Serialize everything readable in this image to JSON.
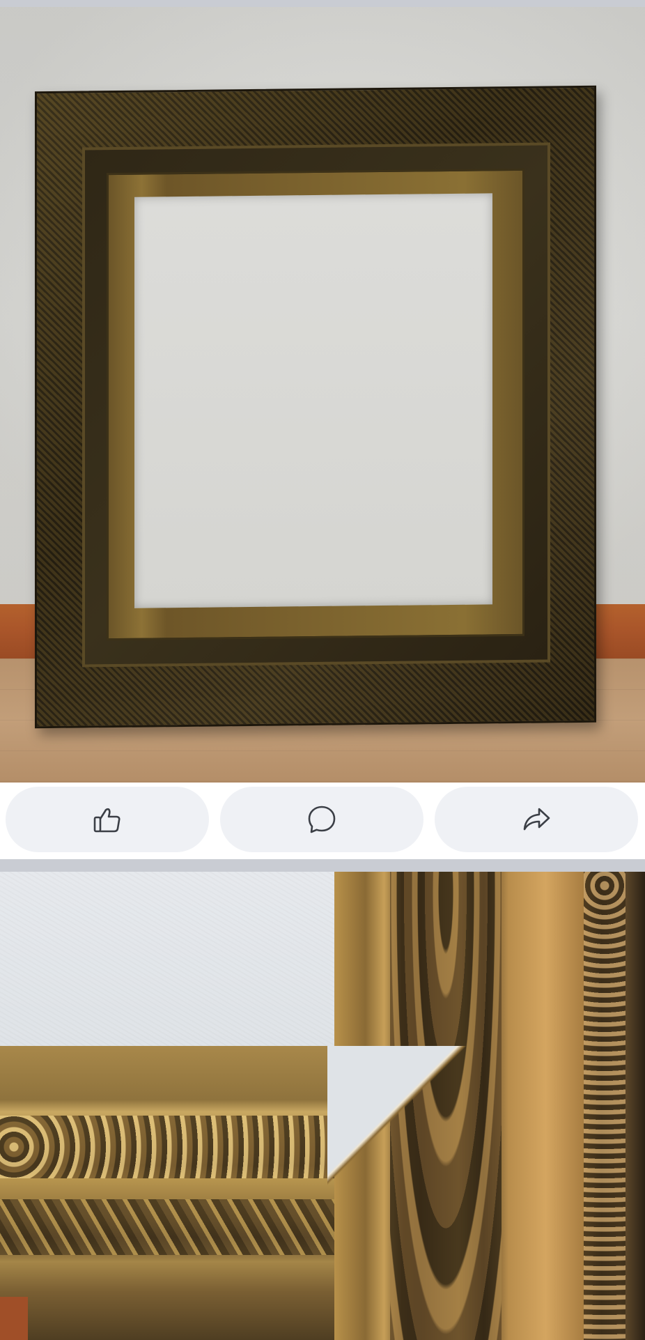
{
  "post": {
    "photos": [
      {
        "subject": "gilded-picture-frame-full"
      },
      {
        "subject": "gilded-picture-frame-corner-detail"
      }
    ]
  },
  "actions": {
    "like_icon": "thumbs-up-icon",
    "comment_icon": "speech-bubble-icon",
    "share_icon": "share-arrow-icon"
  },
  "colors": {
    "button_bg": "#eff1f5",
    "icon_stroke": "#3b3f46",
    "divider": "#c9ccd3",
    "card_bg": "#ffffff"
  }
}
